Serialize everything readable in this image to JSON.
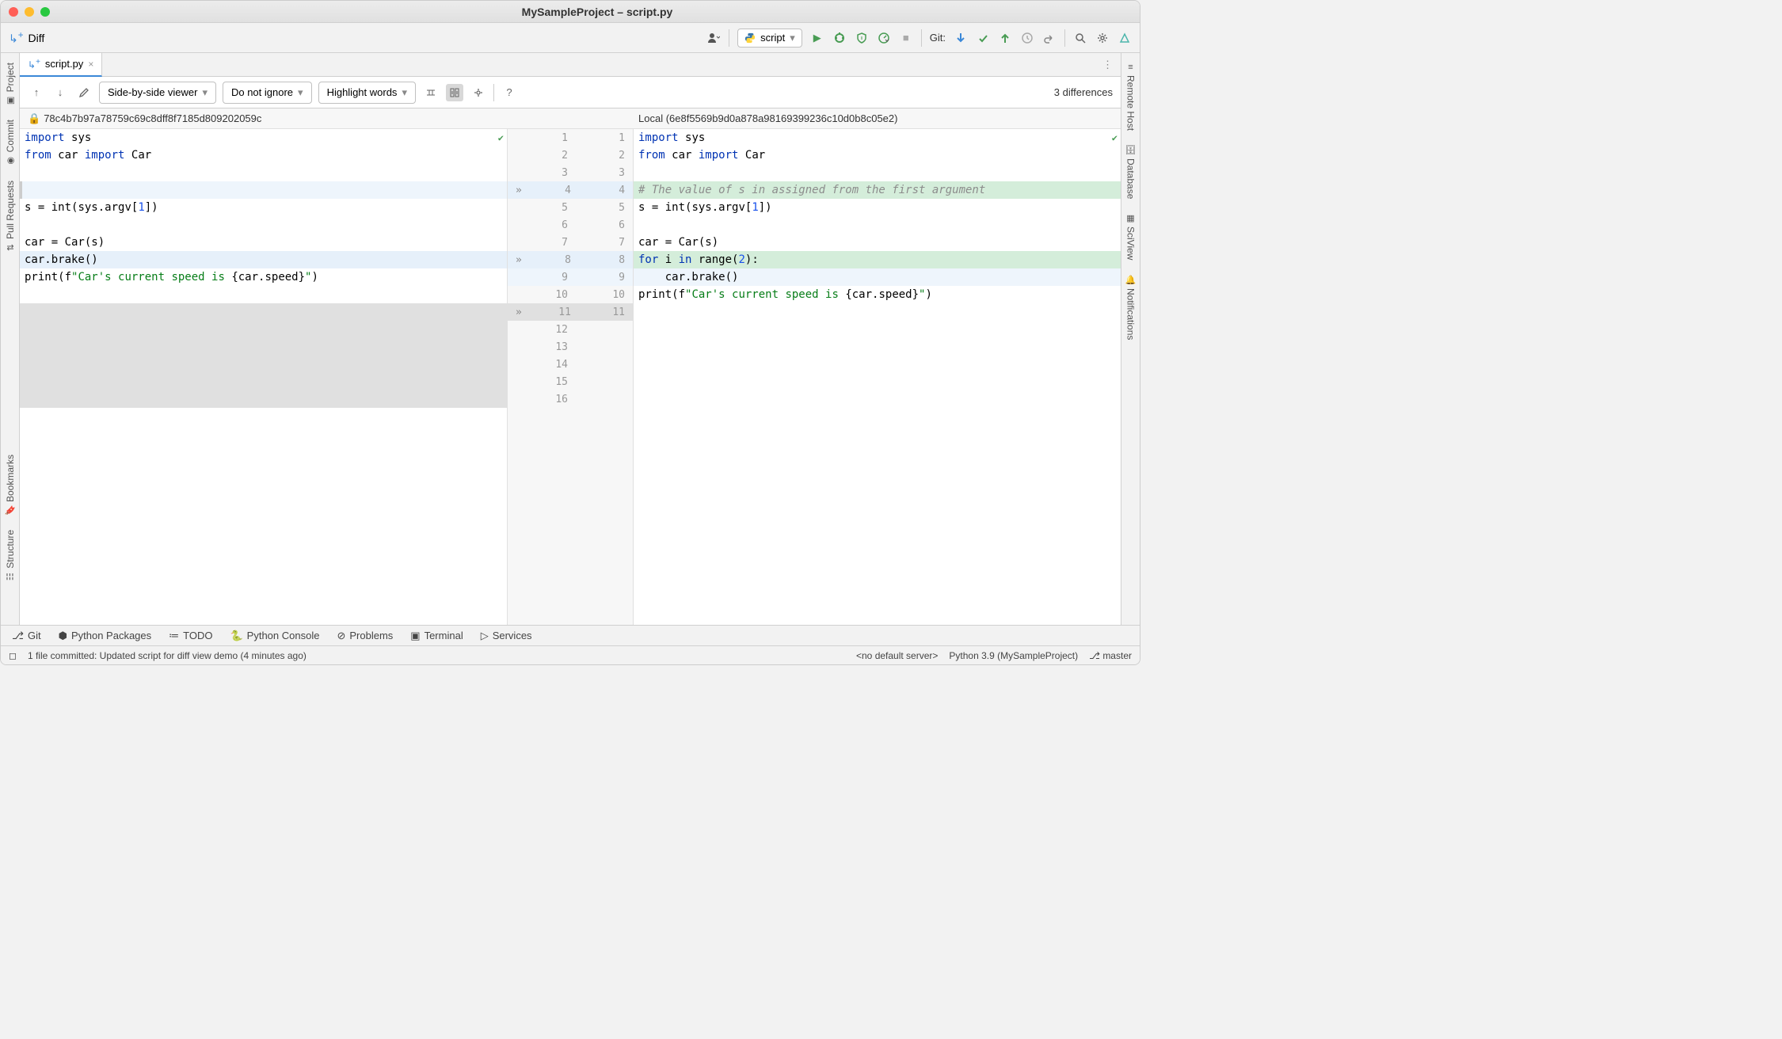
{
  "window": {
    "title": "MySampleProject – script.py"
  },
  "maintoolbar": {
    "diff_label": "Diff",
    "run_config": "script",
    "git_label": "Git:"
  },
  "tab": {
    "filename": "script.py"
  },
  "difftoolbar": {
    "viewer_mode": "Side-by-side viewer",
    "ignore_mode": "Do not ignore",
    "highlight_mode": "Highlight words",
    "diff_count": "3 differences"
  },
  "revisions": {
    "left": "78c4b7b97a78759c69c8dff8f7185d809202059c",
    "right": "Local (6e8f5569b9d0a878a98169399236c10d0b8c05e2)"
  },
  "left_stripe": {
    "project": "Project",
    "commit": "Commit",
    "pull_requests": "Pull Requests",
    "bookmarks": "Bookmarks",
    "structure": "Structure"
  },
  "right_stripe": {
    "remote_host": "Remote Host",
    "database": "Database",
    "sciview": "SciView",
    "notifications": "Notifications"
  },
  "left_code": {
    "l1": {
      "pre": "import ",
      "id": "sys"
    },
    "l2": {
      "pre": "from ",
      "m": "car ",
      "kw": "import ",
      "id": "Car"
    },
    "l3": "",
    "l4": "",
    "l5": {
      "a": "s = ",
      "fn": "int",
      "b": "(sys.argv[",
      "n": "1",
      "c": "])"
    },
    "l6": "",
    "l7": "car = Car(s)",
    "l8": "car.brake()",
    "l9": {
      "a": "print",
      "b": "(f",
      "s": "\"Car's current speed is ",
      "c": "{car.speed}",
      "s2": "\"",
      "d": ")"
    },
    "l10": "",
    "l11": ""
  },
  "right_code": {
    "l1": {
      "pre": "import ",
      "id": "sys"
    },
    "l2": {
      "pre": "from ",
      "m": "car ",
      "kw": "import ",
      "id": "Car"
    },
    "l3": "",
    "l4": "# The value of s in assigned from the first argument",
    "l5": {
      "a": "s = ",
      "fn": "int",
      "b": "(sys.argv[",
      "n": "1",
      "c": "])"
    },
    "l6": "",
    "l7": "car = Car(s)",
    "l8": {
      "a": "for ",
      "b": "i ",
      "c": "in ",
      "d": "range",
      "e": "(",
      "n": "2",
      "f": "):"
    },
    "l9": "    car.brake()",
    "l10": {
      "a": "print",
      "b": "(f",
      "s": "\"Car's current speed is ",
      "c": "{car.speed}",
      "s2": "\"",
      "d": ")"
    },
    "l11": ""
  },
  "gutter": {
    "rows": [
      {
        "l": "1",
        "r": "1"
      },
      {
        "l": "2",
        "r": "2"
      },
      {
        "l": "3",
        "r": "3"
      },
      {
        "l": "4",
        "r": "4",
        "chev": true,
        "blue": true
      },
      {
        "l": "5",
        "r": "5"
      },
      {
        "l": "6",
        "r": "6"
      },
      {
        "l": "7",
        "r": "7"
      },
      {
        "l": "8",
        "r": "8",
        "chev": true,
        "blue": true
      },
      {
        "l": "9",
        "r": "9",
        "lightblue": true
      },
      {
        "l": "10",
        "r": "10"
      },
      {
        "l": "11",
        "r": "11",
        "chev": true,
        "gray": true
      },
      {
        "l": "12",
        "r": ""
      },
      {
        "l": "13",
        "r": ""
      },
      {
        "l": "14",
        "r": ""
      },
      {
        "l": "15",
        "r": ""
      },
      {
        "l": "16",
        "r": ""
      }
    ]
  },
  "toolwindows": {
    "git": "Git",
    "packages": "Python Packages",
    "todo": "TODO",
    "console": "Python Console",
    "problems": "Problems",
    "terminal": "Terminal",
    "services": "Services"
  },
  "statusbar": {
    "message": "1 file committed: Updated script for diff view demo (4 minutes ago)",
    "server": "<no default server>",
    "interpreter": "Python 3.9 (MySampleProject)",
    "branch": "master"
  }
}
